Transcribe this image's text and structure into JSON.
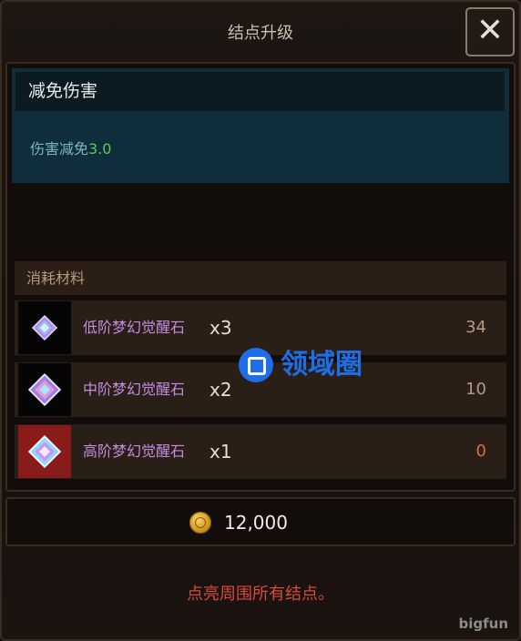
{
  "dialog": {
    "title": "结点升级",
    "close_label": "✕"
  },
  "effect": {
    "name": "减免伤害",
    "desc_label": "伤害减免",
    "desc_value": "3.0"
  },
  "materials": {
    "header": "消耗材料",
    "items": [
      {
        "name": "低阶梦幻觉醒石",
        "qty": "x3",
        "owned": "34",
        "icon": "low-gem-icon"
      },
      {
        "name": "中阶梦幻觉醒石",
        "qty": "x2",
        "owned": "10",
        "icon": "mid-gem-icon"
      },
      {
        "name": "高阶梦幻觉醒石",
        "qty": "x1",
        "owned": "0",
        "icon": "high-gem-icon"
      }
    ]
  },
  "cost": {
    "value": "12,000",
    "icon": "gold-coin-icon"
  },
  "hint": "点亮周围所有结点。",
  "watermark": "领域圈",
  "brand": "bigfun",
  "colors": {
    "shortage": "#e06a44",
    "effect_value": "#5ec95a",
    "material_name": "#c48be0"
  }
}
